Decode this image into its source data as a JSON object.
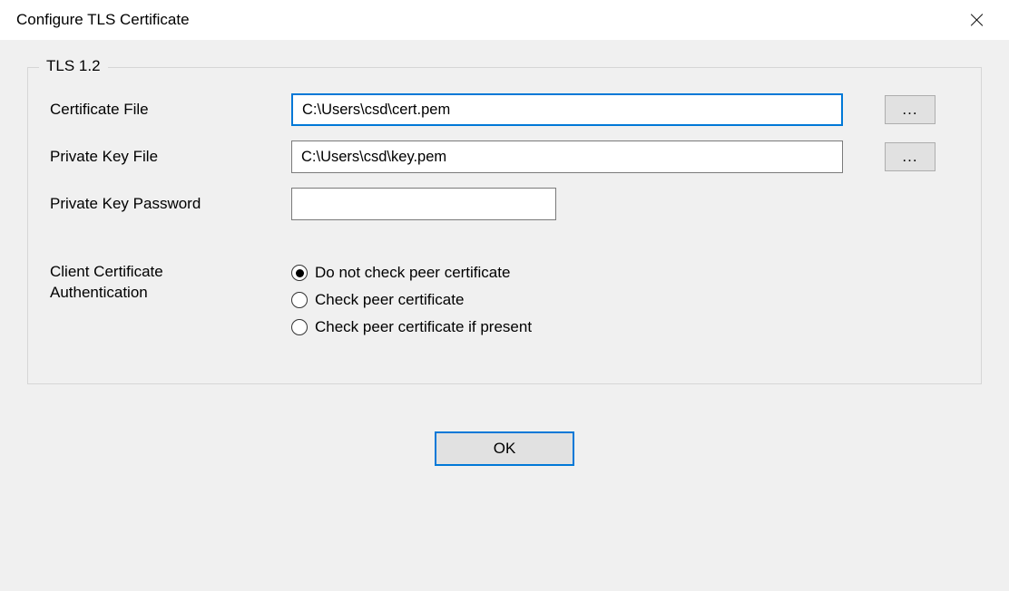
{
  "window": {
    "title": "Configure TLS Certificate"
  },
  "group": {
    "title": "TLS 1.2",
    "cert_file": {
      "label": "Certificate File",
      "value": "C:\\Users\\csd\\cert.pem",
      "browse": "..."
    },
    "key_file": {
      "label": "Private Key File",
      "value": "C:\\Users\\csd\\key.pem",
      "browse": "..."
    },
    "key_password": {
      "label": "Private Key Password",
      "value": ""
    },
    "client_auth": {
      "label": "Client Certificate Authentication",
      "options": [
        {
          "label": "Do not check peer certificate",
          "checked": true
        },
        {
          "label": "Check peer certificate",
          "checked": false
        },
        {
          "label": "Check peer certificate if present",
          "checked": false
        }
      ]
    }
  },
  "buttons": {
    "ok": "OK"
  }
}
